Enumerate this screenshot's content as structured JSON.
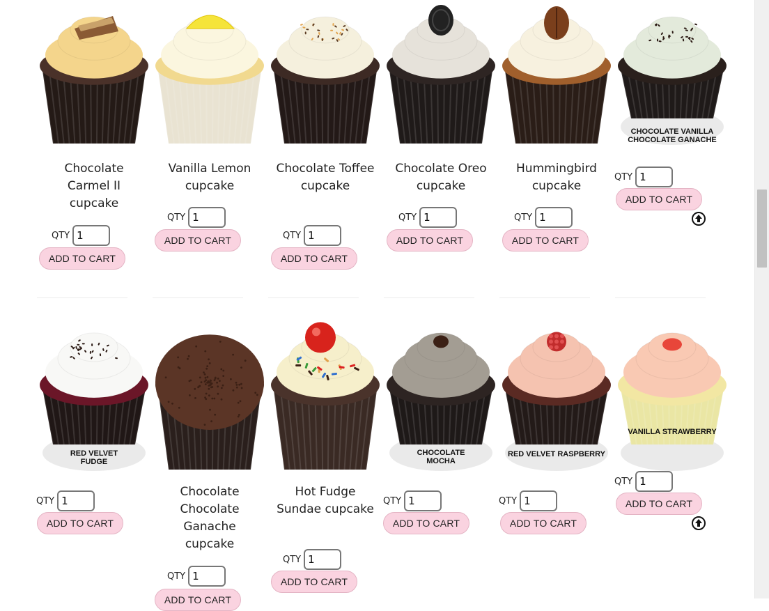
{
  "row1": [
    {
      "name": "Chocolate Carmel II cupcake",
      "qty_label": "QTY",
      "qty": "1",
      "button": "ADD TO CART",
      "frosting": "#f4d58c",
      "cake": "#4a3129",
      "liner": "#241a16",
      "topping": "toffee"
    },
    {
      "name": "Vanilla Lemon cupcake",
      "qty_label": "QTY",
      "qty": "1",
      "button": "ADD TO CART",
      "frosting": "#fbf6df",
      "cake": "#f1d98f",
      "liner": "#e9e3d2",
      "topping": "lemon"
    },
    {
      "name": "Chocolate Toffee cupcake",
      "qty_label": "QTY",
      "qty": "1",
      "button": "ADD TO CART",
      "frosting": "#f5f0dd",
      "cake": "#3d2a24",
      "liner": "#231917",
      "topping": "sprinkles"
    },
    {
      "name": "Chocolate Oreo cupcake",
      "qty_label": "QTY",
      "qty": "1",
      "button": "ADD TO CART",
      "frosting": "#e6e2da",
      "cake": "#2e2523",
      "liner": "#1f1a19",
      "topping": "oreo"
    },
    {
      "name": "Hummingbird cupcake",
      "qty_label": "QTY",
      "qty": "1",
      "button": "ADD TO CART",
      "frosting": "#f7f1df",
      "cake": "#a05f2c",
      "liner": "#2a1d17",
      "topping": "pecan"
    },
    {
      "name": "",
      "caption_line1": "CHOCOLATE VANILLA",
      "caption_line2": "CHOCOLATE GANACHE",
      "qty_label": "QTY",
      "qty": "1",
      "button": "ADD TO CART",
      "frosting": "#e3eadb",
      "cake": "#2a201c",
      "liner": "#1f1a19",
      "topping": "choc-sprinkles"
    }
  ],
  "row2": [
    {
      "name": "",
      "caption_line1": "RED VELVET",
      "caption_line2": "FUDGE",
      "qty_label": "QTY",
      "qty": "1",
      "button": "ADD TO CART",
      "frosting": "#f8f8f6",
      "cake": "#6b1628",
      "liner": "#201716",
      "topping": "choc-sprinkles"
    },
    {
      "name": "Chocolate Chocolate Ganache cupcake",
      "qty_label": "QTY",
      "qty": "1",
      "button": "ADD TO CART",
      "frosting": "#5b3526",
      "cake": "#3a2823",
      "liner": "#2a1f1c",
      "topping": "dome"
    },
    {
      "name": "Hot Fudge Sundae cupcake",
      "qty_label": "QTY",
      "qty": "1",
      "button": "ADD TO CART",
      "frosting": "#f6efcb",
      "cake": "#4a332b",
      "liner": "#3a2a24",
      "topping": "cherry"
    },
    {
      "name": "",
      "caption_line1": "CHOCOLATE",
      "caption_line2": "MOCHA",
      "qty_label": "QTY",
      "qty": "1",
      "button": "ADD TO CART",
      "frosting": "#a39d93",
      "cake": "#2d2422",
      "liner": "#1e1918",
      "topping": "bean"
    },
    {
      "name": "",
      "caption_line1": "RED VELVET RASPBERRY",
      "caption_line2": "",
      "qty_label": "QTY",
      "qty": "1",
      "button": "ADD TO CART",
      "frosting": "#f5c3b0",
      "cake": "#5a2a23",
      "liner": "#231a18",
      "topping": "raspberry"
    },
    {
      "name": "",
      "caption_line1": "VANILLA STRAWBERRY",
      "caption_line2": "",
      "qty_label": "QTY",
      "qty": "1",
      "button": "ADD TO CART",
      "frosting": "#f9c9b3",
      "cake": "#f2e7a3",
      "liner": "#eae6a4",
      "topping": "jelly"
    }
  ],
  "colors": {
    "button_bg": "#fad3e0",
    "accent_border": "#e4b4c4"
  }
}
